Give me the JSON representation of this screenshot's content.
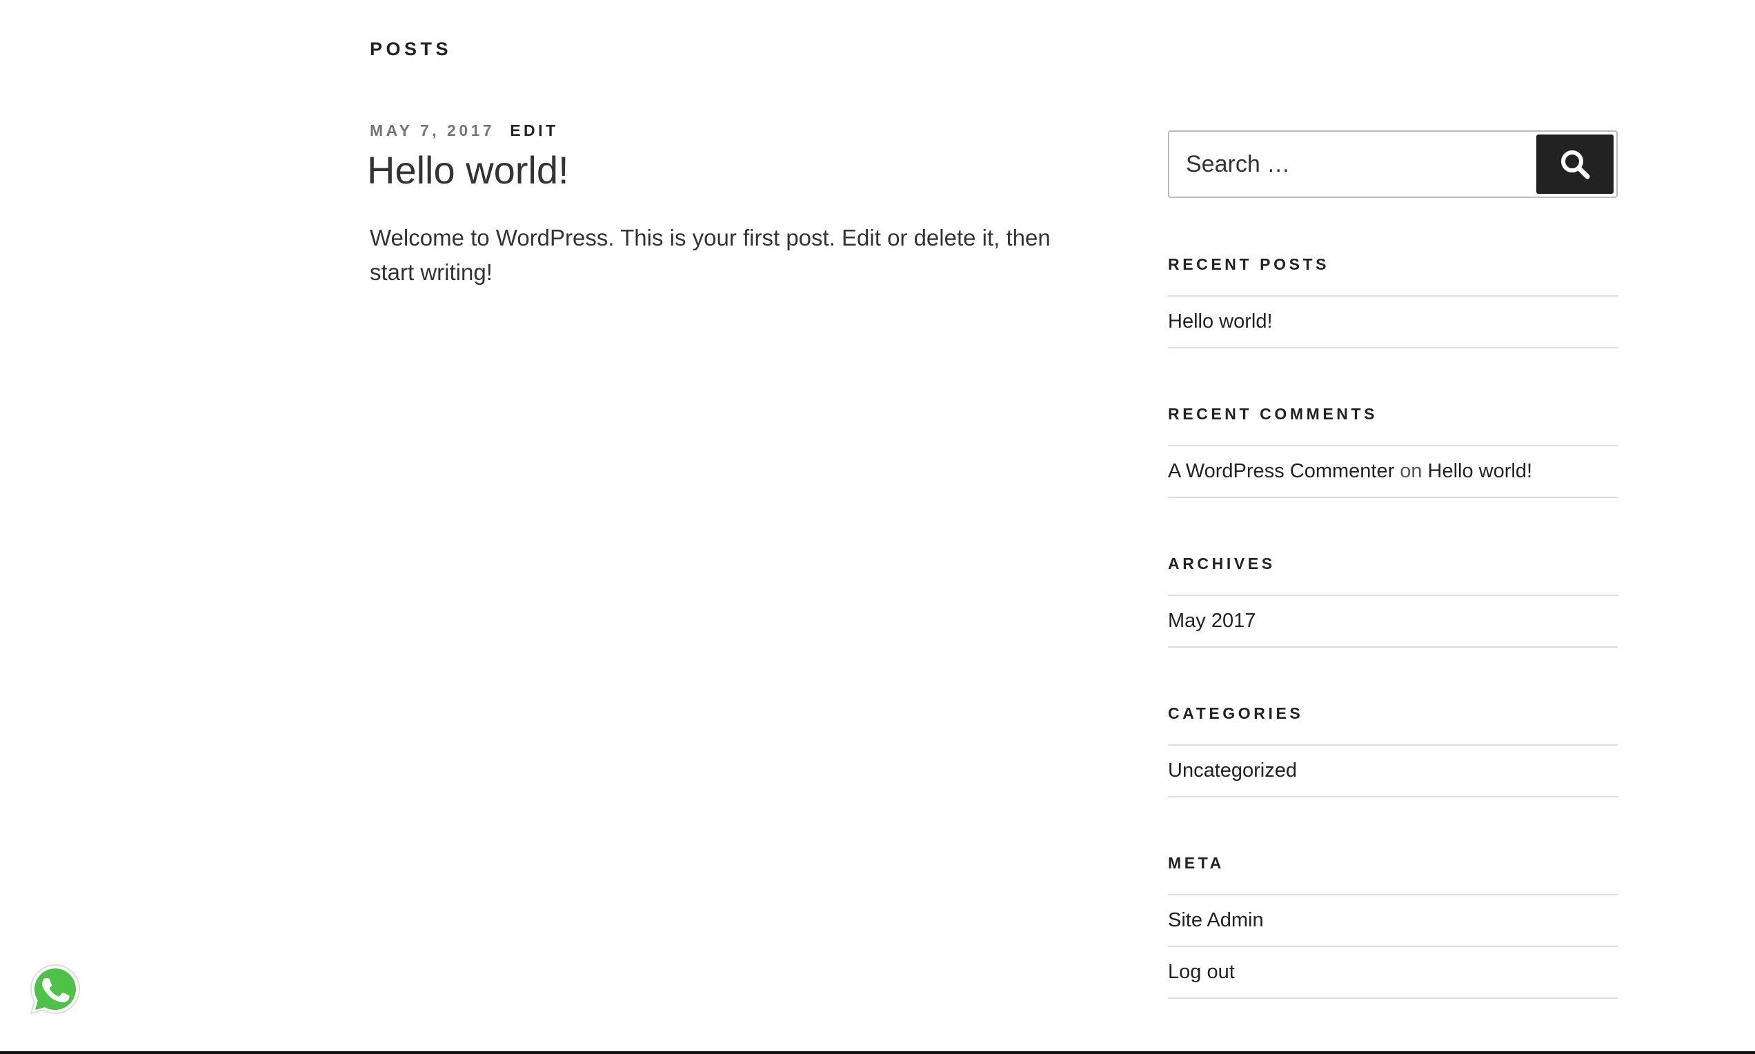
{
  "page_header": "POSTS",
  "post": {
    "date": "MAY 7, 2017",
    "edit_label": "EDIT",
    "title": "Hello world!",
    "body": "Welcome to WordPress. This is your first post. Edit or delete it, then start writing!"
  },
  "search": {
    "placeholder": "Search …",
    "button_icon": "search-icon"
  },
  "widgets": {
    "recent_posts": {
      "title": "RECENT POSTS",
      "items": [
        {
          "label": "Hello world!"
        }
      ]
    },
    "recent_comments": {
      "title": "RECENT COMMENTS",
      "items": [
        {
          "author": "A WordPress Commenter",
          "on": "on",
          "post": "Hello world!"
        }
      ]
    },
    "archives": {
      "title": "ARCHIVES",
      "items": [
        {
          "label": "May 2017"
        }
      ]
    },
    "categories": {
      "title": "CATEGORIES",
      "items": [
        {
          "label": "Uncategorized"
        }
      ]
    },
    "meta": {
      "title": "META",
      "items": [
        {
          "label": "Site Admin"
        },
        {
          "label": "Log out"
        }
      ]
    }
  },
  "floating": {
    "whatsapp_icon": "whatsapp-icon"
  },
  "colors": {
    "text": "#222222",
    "muted": "#767676",
    "button": "#222222",
    "whatsapp": "#4dc247"
  }
}
